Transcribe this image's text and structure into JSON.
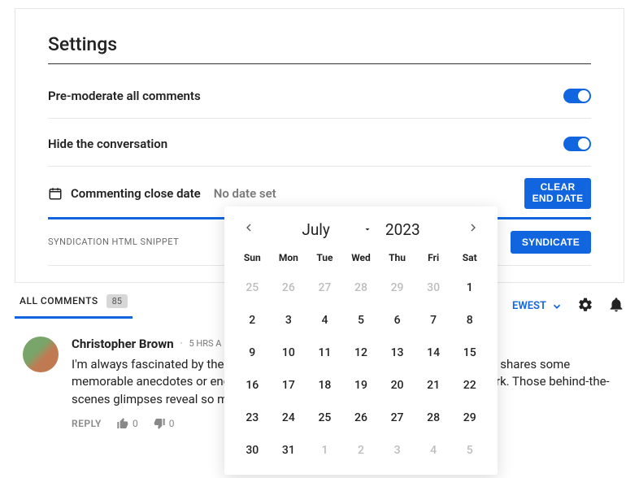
{
  "settings": {
    "title": "Settings",
    "pre_moderate_label": "Pre-moderate all comments",
    "hide_conversation_label": "Hide the conversation",
    "close_date_label": "Commenting close date",
    "close_date_value": "No date set",
    "clear_end_date_btn": "CLEAR END DATE",
    "syndication_label": "SYNDICATION HTML SNIPPET",
    "syndicate_btn": "SYNDICATE"
  },
  "comments_bar": {
    "tab_label": "ALL COMMENTS",
    "count": "85",
    "sort_label": "EWEST"
  },
  "comment": {
    "author": "Christopher Brown",
    "time_sep": "·",
    "timestamp": "5 HRS A",
    "text": "I'm always fascinated by the personal side of these reports. The correspondent shares some memorable anecdotes or encounters that didn't make it into their published work. Those behind-the-scenes glimpses reveal so much.",
    "reply": "REPLY",
    "up": "0",
    "down": "0"
  },
  "datepicker": {
    "month": "July",
    "year": "2023",
    "dow": [
      "Sun",
      "Mon",
      "Tue",
      "Wed",
      "Thu",
      "Fri",
      "Sat"
    ],
    "cells": [
      {
        "d": "25",
        "o": true
      },
      {
        "d": "26",
        "o": true
      },
      {
        "d": "27",
        "o": true
      },
      {
        "d": "28",
        "o": true
      },
      {
        "d": "29",
        "o": true
      },
      {
        "d": "30",
        "o": true
      },
      {
        "d": "1",
        "o": false
      },
      {
        "d": "2",
        "o": false
      },
      {
        "d": "3",
        "o": false
      },
      {
        "d": "4",
        "o": false
      },
      {
        "d": "5",
        "o": false
      },
      {
        "d": "6",
        "o": false
      },
      {
        "d": "7",
        "o": false
      },
      {
        "d": "8",
        "o": false
      },
      {
        "d": "9",
        "o": false
      },
      {
        "d": "10",
        "o": false
      },
      {
        "d": "11",
        "o": false
      },
      {
        "d": "12",
        "o": false
      },
      {
        "d": "13",
        "o": false
      },
      {
        "d": "14",
        "o": false
      },
      {
        "d": "15",
        "o": false
      },
      {
        "d": "16",
        "o": false
      },
      {
        "d": "17",
        "o": false
      },
      {
        "d": "18",
        "o": false
      },
      {
        "d": "19",
        "o": false
      },
      {
        "d": "20",
        "o": false
      },
      {
        "d": "21",
        "o": false
      },
      {
        "d": "22",
        "o": false
      },
      {
        "d": "23",
        "o": false
      },
      {
        "d": "24",
        "o": false
      },
      {
        "d": "25",
        "o": false
      },
      {
        "d": "26",
        "o": false
      },
      {
        "d": "27",
        "o": false
      },
      {
        "d": "28",
        "o": false
      },
      {
        "d": "29",
        "o": false
      },
      {
        "d": "30",
        "o": false
      },
      {
        "d": "31",
        "o": false
      },
      {
        "d": "1",
        "o": true
      },
      {
        "d": "2",
        "o": true
      },
      {
        "d": "3",
        "o": true
      },
      {
        "d": "4",
        "o": true
      },
      {
        "d": "5",
        "o": true
      }
    ]
  }
}
